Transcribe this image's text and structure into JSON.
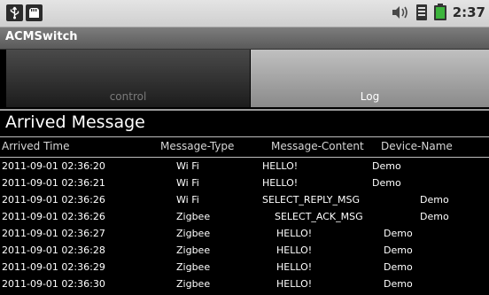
{
  "status_bar": {
    "time": "2:37",
    "left_icons": [
      "usb-icon",
      "sd-card-icon"
    ],
    "right_icons": [
      "vibrate-icon",
      "signal-icon",
      "battery-icon"
    ]
  },
  "app": {
    "title": "ACMSwitch"
  },
  "tabs": [
    {
      "label": "control",
      "selected": false
    },
    {
      "label": "Log",
      "selected": true
    }
  ],
  "heading": "Arrived Message",
  "table": {
    "columns": [
      "Arrived Time",
      "Message-Type",
      "Message-Content",
      "Device-Name"
    ],
    "rows": [
      {
        "time": "2011-09-01 02:36:20",
        "type": "Wi Fi",
        "content": "HELLO!",
        "device": "Demo"
      },
      {
        "time": "2011-09-01 02:36:21",
        "type": "Wi Fi",
        "content": "HELLO!",
        "device": "Demo"
      },
      {
        "time": "2011-09-01 02:36:26",
        "type": "Wi Fi",
        "content": "SELECT_REPLY_MSG",
        "device": "Demo"
      },
      {
        "time": "2011-09-01 02:36:26",
        "type": "Zigbee",
        "content": "SELECT_ACK_MSG",
        "device": "Demo"
      },
      {
        "time": "2011-09-01 02:36:27",
        "type": "Zigbee",
        "content": "HELLO!",
        "device": "Demo"
      },
      {
        "time": "2011-09-01 02:36:28",
        "type": "Zigbee",
        "content": "HELLO!",
        "device": "Demo"
      },
      {
        "time": "2011-09-01 02:36:29",
        "type": "Zigbee",
        "content": "HELLO!",
        "device": "Demo"
      },
      {
        "time": "2011-09-01 02:36:30",
        "type": "Zigbee",
        "content": "HELLO!",
        "device": "Demo"
      }
    ]
  },
  "colors": {
    "background": "#000000",
    "battery": "#3cb43c",
    "header_border": "#bdbdbd"
  }
}
